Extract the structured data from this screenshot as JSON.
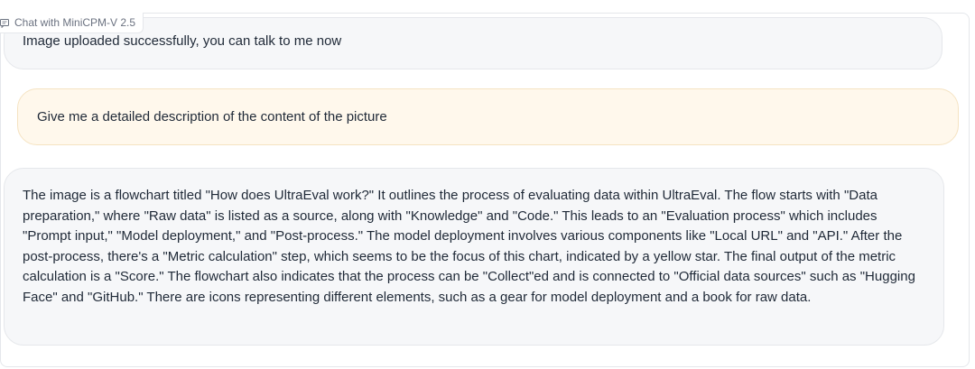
{
  "header": {
    "label": "Chat with MiniCPM-V 2.5",
    "icon": "chat-icon"
  },
  "messages": [
    {
      "role": "assistant",
      "text": "Image uploaded successfully, you can talk to me now"
    },
    {
      "role": "user",
      "text": "Give me a detailed description of the content of the picture"
    },
    {
      "role": "assistant",
      "text": "The image is a flowchart titled \"How does UltraEval work?\" It outlines the process of evaluating data within UltraEval. The flow starts with \"Data preparation,\" where \"Raw data\" is listed as a source, along with \"Knowledge\" and \"Code.\" This leads to an \"Evaluation process\" which includes \"Prompt input,\" \"Model deployment,\" and \"Post-process.\" The model deployment involves various components like \"Local URL\" and \"API.\" After the post-process, there's a \"Metric calculation\" step, which seems to be the focus of this chart, indicated by a yellow star. The final output of the metric calculation is a \"Score.\" The flowchart also indicates that the process can be \"Collect\"ed and is connected to \"Official data sources\" such as \"Hugging Face\" and \"GitHub.\" There are icons representing different elements, such as a gear for model deployment and a book for raw data."
    }
  ],
  "colors": {
    "user_bubble": "#fff8ec",
    "bot_bubble": "#f6f7f9",
    "border": "#e5e7eb"
  }
}
